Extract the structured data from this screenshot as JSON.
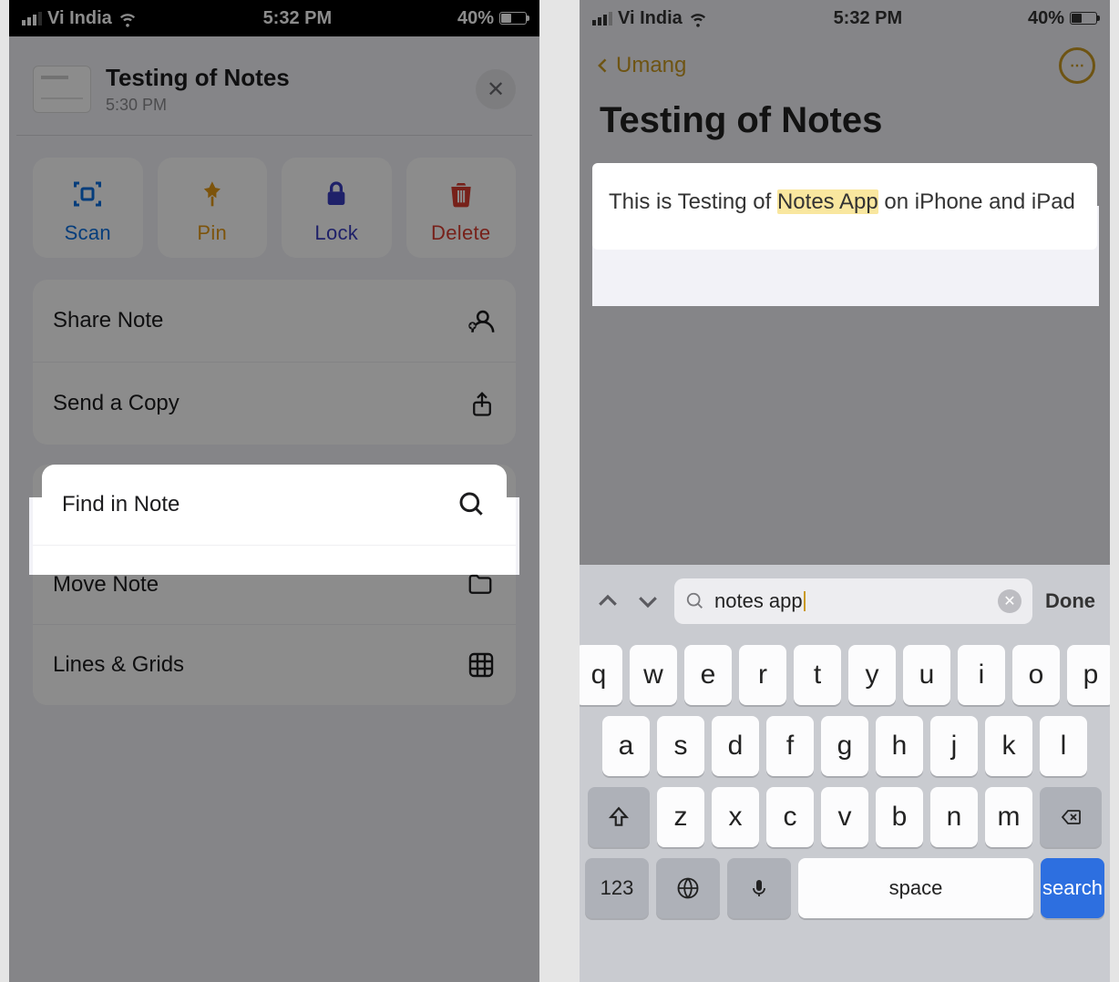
{
  "status": {
    "carrier": "Vi India",
    "time": "5:32 PM",
    "battery_pct": "40%"
  },
  "left": {
    "sheet": {
      "title": "Testing of Notes",
      "subtitle": "5:30 PM"
    },
    "quick": {
      "scan": "Scan",
      "pin": "Pin",
      "lock": "Lock",
      "delete": "Delete"
    },
    "rows": {
      "share": "Share Note",
      "send_copy": "Send a Copy",
      "find": "Find in Note",
      "move": "Move Note",
      "lines": "Lines & Grids"
    }
  },
  "right": {
    "back_label": "Umang",
    "note_title": "Testing of Notes",
    "body_pre": "This is Testing of ",
    "body_hl": "Notes App",
    "body_post": " on iPhone and iPad",
    "search_value": "notes app",
    "done": "Done",
    "keys": {
      "row1": [
        "q",
        "w",
        "e",
        "r",
        "t",
        "y",
        "u",
        "i",
        "o",
        "p"
      ],
      "row2": [
        "a",
        "s",
        "d",
        "f",
        "g",
        "h",
        "j",
        "k",
        "l"
      ],
      "row3": [
        "z",
        "x",
        "c",
        "v",
        "b",
        "n",
        "m"
      ],
      "numeric": "123",
      "space": "space",
      "search": "search"
    }
  }
}
